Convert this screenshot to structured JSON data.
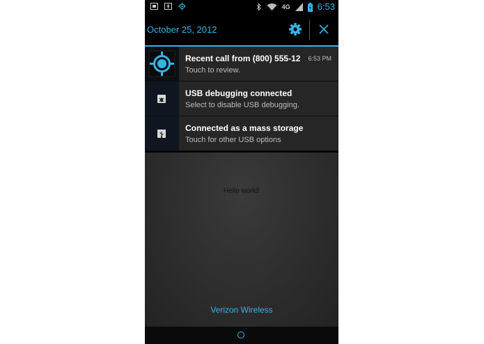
{
  "status_bar": {
    "time": "6:53",
    "network": "4G",
    "icons": [
      "photo-icon",
      "usb-icon",
      "gps-icon",
      "bluetooth-icon",
      "wifi-icon",
      "signal-icon",
      "battery-icon"
    ]
  },
  "header": {
    "date": "October 25, 2012",
    "settings_icon": "gear-icon",
    "close_icon": "close-icon"
  },
  "notifications": [
    {
      "title": "Recent call from (800) 555-12",
      "subtitle": "Touch to review.",
      "time": "6:53 PM",
      "icon": "gps-target-icon"
    },
    {
      "title": "USB debugging connected",
      "subtitle": "Select to disable USB debugging.",
      "icon": "bug-icon"
    },
    {
      "title": "Connected as a mass storage",
      "subtitle": "Touch for other USB options",
      "icon": "usb-icon"
    }
  ],
  "app": {
    "message": "Hello world!",
    "carrier": "Verizon Wireless"
  },
  "colors": {
    "accent": "#33b5e5",
    "panel": "#262626",
    "background": "#000000"
  }
}
